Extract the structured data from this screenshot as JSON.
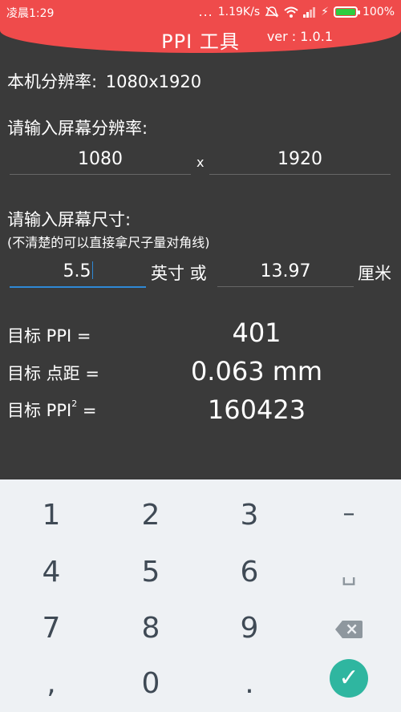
{
  "status_bar": {
    "time": "凌晨1:29",
    "dots": "...",
    "network_speed": "1.19K/s",
    "battery_percent": "100%",
    "battery_level": 1.0
  },
  "header": {
    "title": "PPI 工具",
    "version": "ver : 1.0.1"
  },
  "device_resolution": {
    "label": "本机分辨率:",
    "value": "1080x1920"
  },
  "screen_resolution": {
    "label": "请输入屏幕分辨率:",
    "width": "1080",
    "separator": "x",
    "height": "1920"
  },
  "screen_size": {
    "label": "请输入屏幕尺寸:",
    "hint": "(不清楚的可以直接拿尺子量对角线)",
    "inches_value": "5.5",
    "inches_unit": "英寸 或",
    "cm_value": "13.97",
    "cm_unit": "厘米"
  },
  "results": {
    "ppi_label": "目标 PPI =",
    "ppi_value": "401",
    "pitch_label": "目标 点距 =",
    "pitch_value": "0.063 mm",
    "ppi_sq_label_prefix": "目标 PPI",
    "ppi_sq_sup": "2",
    "ppi_sq_label_suffix": " =",
    "ppi_sq_value": "160423"
  },
  "keyboard": {
    "keys": [
      "1",
      "2",
      "3",
      "–",
      "4",
      "5",
      "6",
      "␣",
      "7",
      "8",
      "9",
      ",",
      "0",
      "."
    ],
    "done_icon": "check-icon",
    "backspace_icon": "backspace-icon"
  },
  "colors": {
    "header": "#ef4b4b",
    "background": "#3a3a3a",
    "keyboard": "#eef1f4",
    "accent": "#2f89d6",
    "done": "#2fb6a0"
  }
}
